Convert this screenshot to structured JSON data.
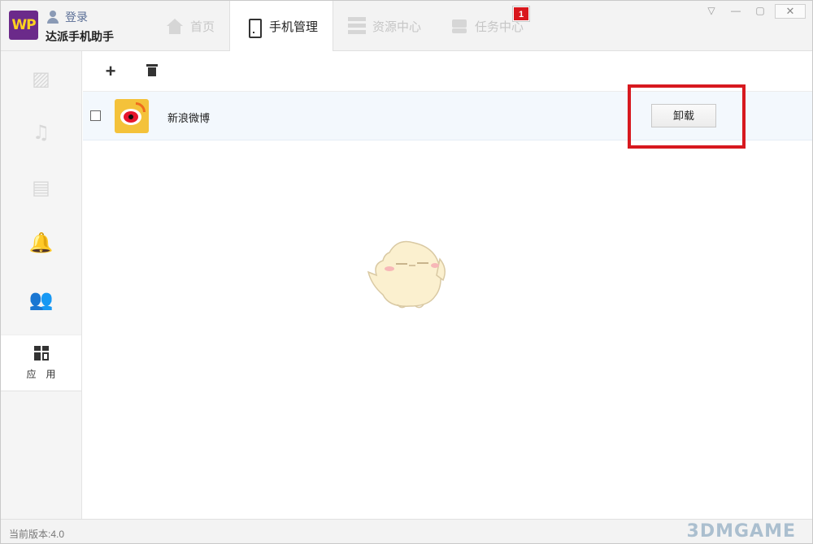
{
  "titlebar": {
    "logo_text": "WP",
    "login_label": "登录",
    "app_name": "达派手机助手"
  },
  "tabs": [
    {
      "label": "首页",
      "icon": "home-icon",
      "active": false
    },
    {
      "label": "手机管理",
      "icon": "phone-icon",
      "active": true
    },
    {
      "label": "资源中心",
      "icon": "list-icon",
      "active": false
    },
    {
      "label": "任务中心",
      "icon": "layers-icon",
      "active": false
    }
  ],
  "task_badge": "1",
  "window_controls": {
    "menu": "▽",
    "minimize": "—",
    "maximize": "▢",
    "close": "✕"
  },
  "sidebar": {
    "items": [
      {
        "icon": "photo-icon",
        "glyph": "▨"
      },
      {
        "icon": "music-icon",
        "glyph": "♫"
      },
      {
        "icon": "video-icon",
        "glyph": "▤"
      },
      {
        "icon": "ringtone-icon",
        "glyph": "🔔"
      },
      {
        "icon": "contacts-icon",
        "glyph": "👥"
      }
    ],
    "active_label": "应用"
  },
  "toolbar": {
    "add": "+"
  },
  "apps": [
    {
      "name": "新浪微博",
      "checked": false,
      "action": "卸载"
    }
  ],
  "status": {
    "version": "当前版本:4.0"
  },
  "watermark": "3DMGAME",
  "colors": {
    "accent_red": "#d7191f",
    "badge_red": "#d9161c",
    "row_bg": "#f3f8fd",
    "logo_purple": "#6b2a8a"
  }
}
